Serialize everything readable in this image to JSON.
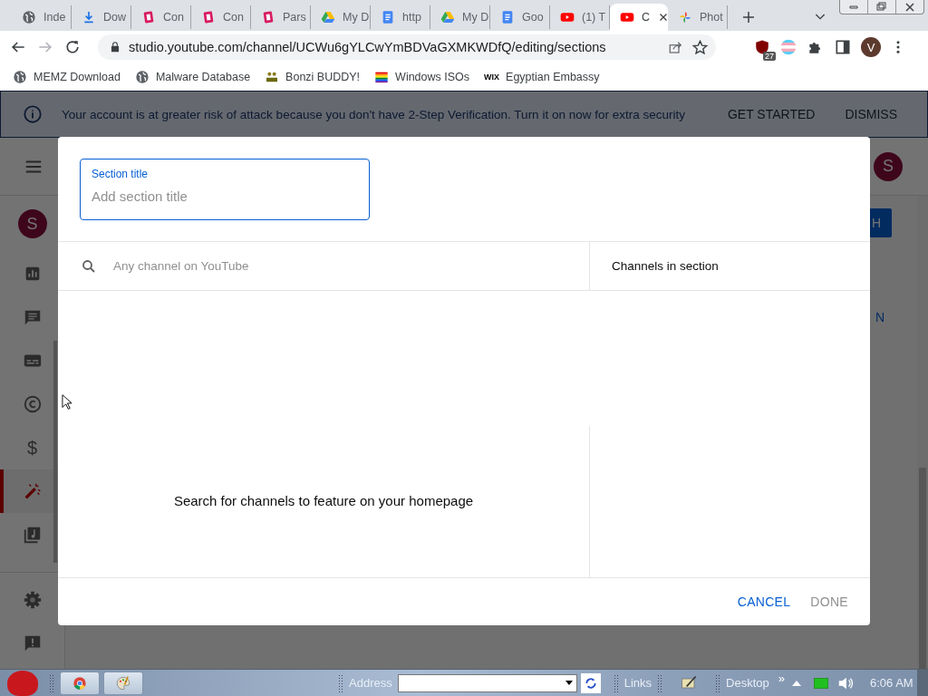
{
  "browser": {
    "tabs": [
      {
        "title": "Inde",
        "kind": "globe",
        "selected": false
      },
      {
        "title": "Dow",
        "kind": "download",
        "selected": false
      },
      {
        "title": "Con",
        "kind": "pink",
        "selected": false
      },
      {
        "title": "Con",
        "kind": "pink",
        "selected": false
      },
      {
        "title": "Pars",
        "kind": "pink",
        "selected": false
      },
      {
        "title": "My D",
        "kind": "drive",
        "selected": false
      },
      {
        "title": "http",
        "kind": "docs",
        "selected": false
      },
      {
        "title": "My D",
        "kind": "drive",
        "selected": false
      },
      {
        "title": "Goo",
        "kind": "docs",
        "selected": false
      },
      {
        "title": "(1) T",
        "kind": "youtube",
        "selected": false
      },
      {
        "title": "C",
        "kind": "youtube",
        "selected": true
      },
      {
        "title": "Phot",
        "kind": "photos",
        "selected": false
      }
    ],
    "address": "studio.youtube.com/channel/UCWu6gYLCwYmBDVaGXMKWDfQ/editing/sections",
    "extension_badge": "27",
    "profile_initial": "V",
    "bookmarks": [
      {
        "label": "MEMZ Download",
        "kind": "globe"
      },
      {
        "label": "Malware Database",
        "kind": "globe"
      },
      {
        "label": "Bonzi BUDDY!",
        "kind": "figure"
      },
      {
        "label": "Windows ISOs",
        "kind": "flag"
      },
      {
        "label": "Egyptian Embassy",
        "kind": "wix",
        "mark": "WIX"
      }
    ]
  },
  "banner": {
    "message": "Your account is at greater risk of attack because you don't have 2-Step Verification. Turn it on now for extra security",
    "actions": [
      "GET STARTED",
      "DISMISS"
    ]
  },
  "studio": {
    "header_avatar_initial": "S",
    "channel_avatar_initial": "S",
    "sidebar_items": [
      {
        "kind": "analytics",
        "selected": false
      },
      {
        "kind": "comments",
        "selected": false
      },
      {
        "kind": "subtitles",
        "selected": false
      },
      {
        "kind": "copyright",
        "selected": false
      },
      {
        "kind": "earn",
        "glyph": "$",
        "selected": false
      },
      {
        "kind": "customization",
        "selected": true
      },
      {
        "kind": "audio",
        "selected": false
      }
    ],
    "footer_items": [
      {
        "kind": "settings"
      },
      {
        "kind": "feedback"
      }
    ],
    "button_fragment": "H",
    "link_fragment": "N"
  },
  "dialog": {
    "title_field": {
      "label": "Section title",
      "placeholder": "Add section title"
    },
    "search": {
      "placeholder": "Any channel on YouTube"
    },
    "selected_header": "Channels in section",
    "empty_message": "Search for channels to feature on your homepage",
    "buttons": [
      {
        "label": "CANCEL",
        "disabled": false
      },
      {
        "label": "DONE",
        "disabled": true
      }
    ]
  },
  "taskbar": {
    "address_label": "Address",
    "links_label": "Links",
    "desktop_label": "Desktop",
    "more": "»",
    "clock": "6:06 AM"
  }
}
